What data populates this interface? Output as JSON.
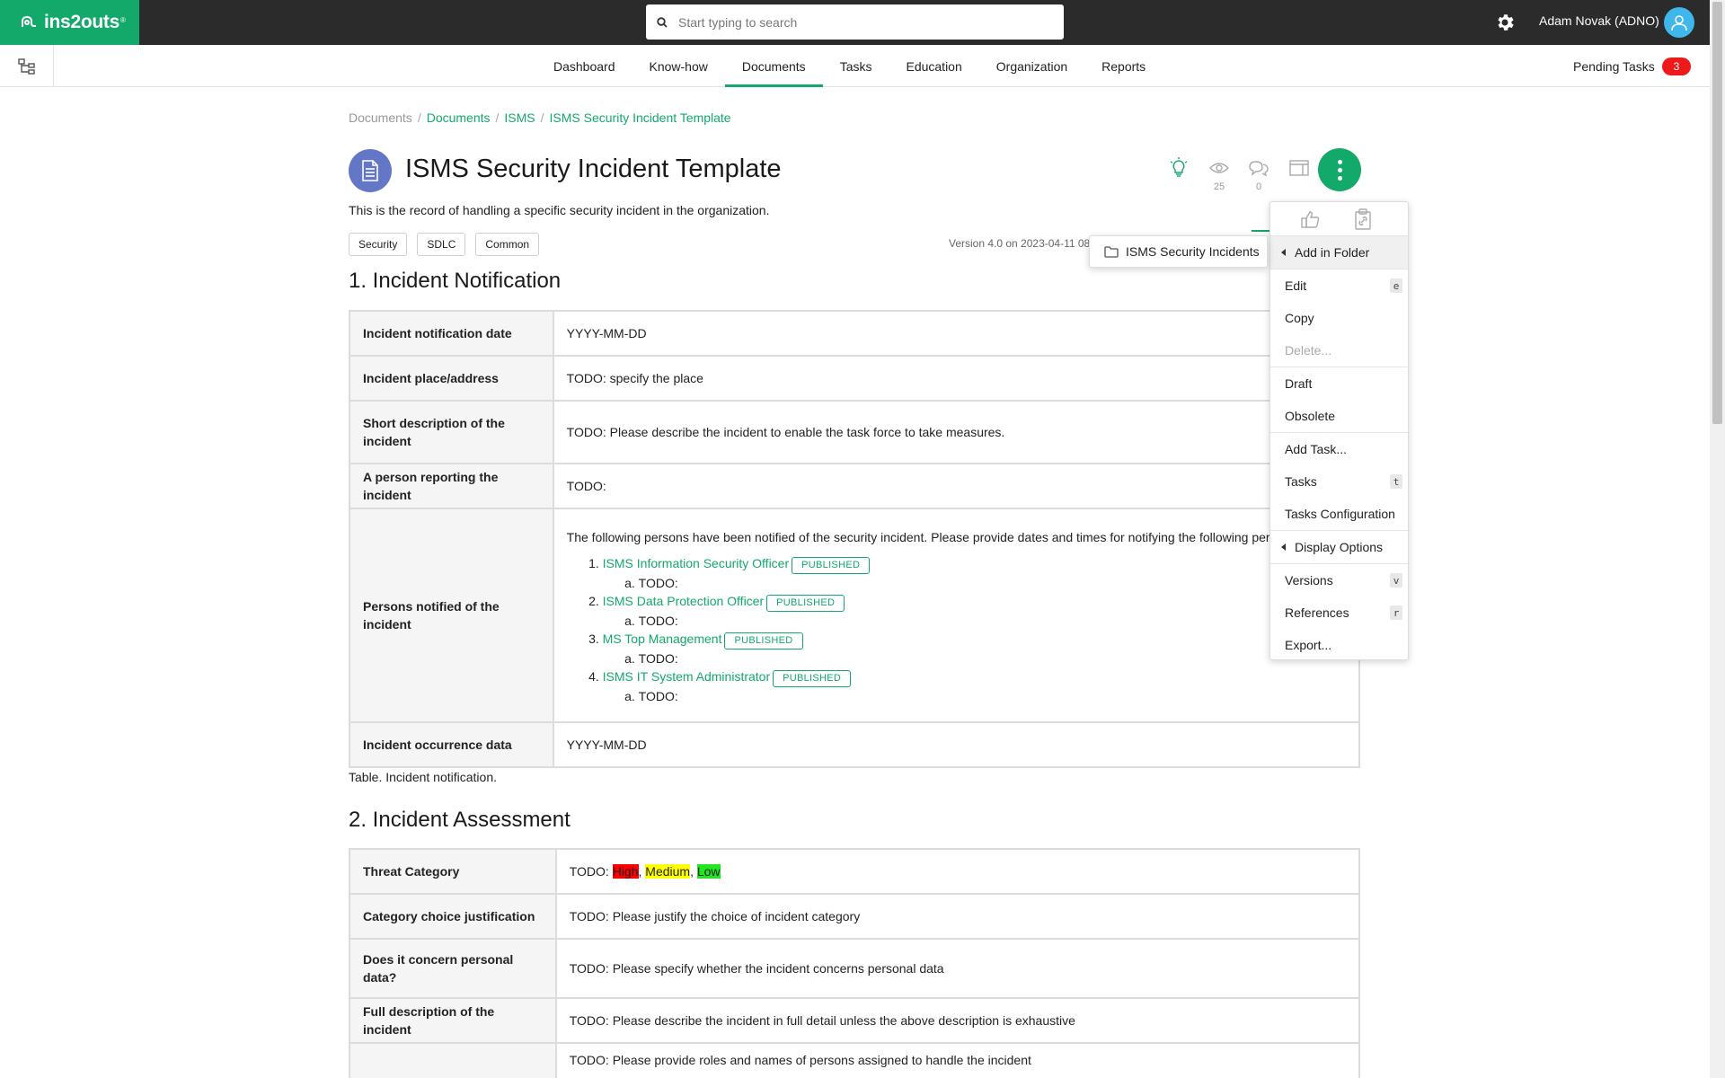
{
  "app": {
    "logo_text": "ins2outs",
    "logo_reg": "®"
  },
  "topbar": {
    "search_placeholder": "Start typing to search",
    "user_name": "Adam Novak (ADNO)"
  },
  "nav": {
    "items": [
      {
        "label": "Dashboard"
      },
      {
        "label": "Know-how"
      },
      {
        "label": "Documents",
        "active": true
      },
      {
        "label": "Tasks"
      },
      {
        "label": "Education"
      },
      {
        "label": "Organization"
      },
      {
        "label": "Reports"
      }
    ],
    "pending_label": "Pending Tasks",
    "pending_count": "3"
  },
  "breadcrumb": {
    "items": [
      "Documents",
      "Documents",
      "ISMS",
      "ISMS Security Incident Template"
    ],
    "separator": "/"
  },
  "document": {
    "title": "ISMS Security Incident Template",
    "subtitle": "This is the record of handling a specific security incident in the organization.",
    "tags": [
      "Security",
      "SDLC",
      "Common"
    ],
    "version": "Version 4.0 on 2023-04-11 08",
    "views_count": "25",
    "comments_count": "0"
  },
  "section1": {
    "heading": "1. Incident Notification",
    "rows": [
      {
        "label": "Incident notification date",
        "value": "YYYY-MM-DD"
      },
      {
        "label": "Incident place/address",
        "value": "TODO: specify the place"
      },
      {
        "label": "Short description of the incident",
        "value": "TODO: Please describe the incident to enable the task force to take measures."
      },
      {
        "label": "A person reporting the incident",
        "value": "TODO:"
      },
      {
        "label": "Persons notified of the incident",
        "value": ""
      },
      {
        "label": "Incident occurrence data",
        "value": "YYYY-MM-DD"
      }
    ],
    "persons_intro": "The following persons have been notified of the security incident. Please provide dates and times for notifying the following persons:",
    "persons": [
      {
        "name": "ISMS Information Security Officer",
        "status": "PUBLISHED",
        "sub": "TODO:"
      },
      {
        "name": "ISMS Data Protection Officer",
        "status": "PUBLISHED",
        "sub": "TODO:"
      },
      {
        "name": "MS Top Management",
        "status": "PUBLISHED",
        "sub": "TODO:"
      },
      {
        "name": "ISMS IT System Administrator",
        "status": "PUBLISHED",
        "sub": "TODO:"
      }
    ],
    "caption": "Table. Incident notification."
  },
  "section2": {
    "heading": "2. Incident Assessment",
    "threat_label": "Threat Category",
    "threat_prefix": "TODO: ",
    "threat_high": "High",
    "threat_medium": "Medium",
    "threat_low": "Low",
    "threat_sep": ", ",
    "rows": [
      {
        "label": "Category choice justification",
        "value": "TODO: Please justify the choice of incident category"
      },
      {
        "label": "Does it concern personal data?",
        "value": "TODO: Please specify whether the incident concerns personal data"
      },
      {
        "label": "Full description of the incident",
        "value": "TODO: Please describe the incident in full detail unless the above description is exhaustive"
      },
      {
        "label": "",
        "value": "TODO: Please provide roles and names of persons assigned to handle the incident"
      }
    ]
  },
  "menu": {
    "add_in_folder": "Add in Folder",
    "edit": "Edit",
    "edit_key": "e",
    "copy": "Copy",
    "delete": "Delete...",
    "draft": "Draft",
    "obsolete": "Obsolete",
    "add_task": "Add Task...",
    "tasks": "Tasks",
    "tasks_key": "t",
    "tasks_config": "Tasks Configuration",
    "display_options": "Display Options",
    "versions": "Versions",
    "versions_key": "v",
    "references": "References",
    "references_key": "r",
    "export": "Export..."
  },
  "submenu": {
    "folder": "ISMS Security Incidents"
  },
  "colors": {
    "brand": "#12a96b",
    "topbar": "#2b2b2b",
    "badge": "#ee1a1a",
    "doc_icon": "#6477c7",
    "avatar": "#3fb6ec"
  }
}
